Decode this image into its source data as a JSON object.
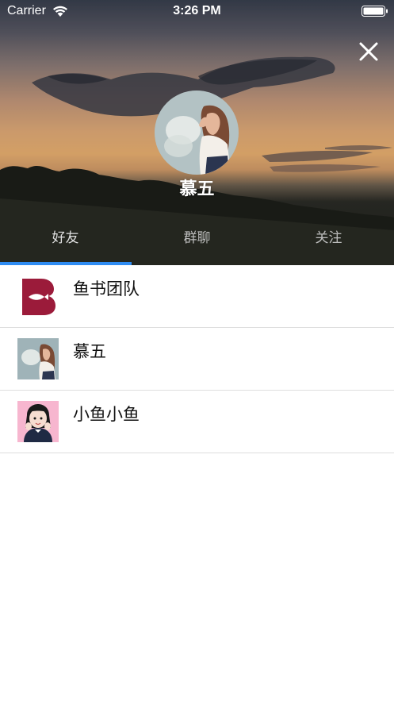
{
  "status_bar": {
    "carrier": "Carrier",
    "time": "3:26 PM"
  },
  "profile": {
    "name": "慕五"
  },
  "tabs": [
    {
      "label": "好友",
      "active": true
    },
    {
      "label": "群聊",
      "active": false
    },
    {
      "label": "关注",
      "active": false
    }
  ],
  "contacts": [
    {
      "name": "鱼书团队",
      "avatar": "booksfish-logo"
    },
    {
      "name": "慕五",
      "avatar": "girl-photo"
    },
    {
      "name": "小鱼小鱼",
      "avatar": "cartoon-girl-photo"
    }
  ],
  "colors": {
    "tab_indicator": "#2f8cf2",
    "logo_red": "#9b1b3a",
    "separator": "#dedede"
  }
}
